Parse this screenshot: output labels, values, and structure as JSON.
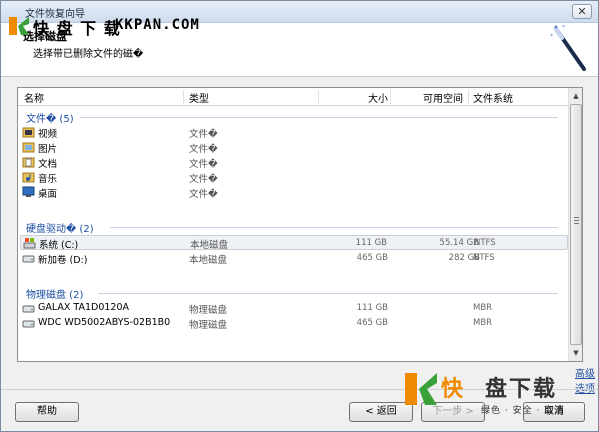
{
  "window": {
    "title": "文件恢复向导",
    "close_glyph": "✕"
  },
  "watermark_top": {
    "text_cn": "快 盘 下 载",
    "text_en": "KKPAN.COM"
  },
  "header": {
    "heading": "选择磁盘",
    "subtitle": "选择带已删除文件的磁�"
  },
  "columns": [
    "名称",
    "类型",
    "大小",
    "可用空间",
    "文件系统"
  ],
  "groups": [
    {
      "label": "文件� (5)",
      "rows": [
        {
          "name": "视频",
          "type": "文件�",
          "size": "",
          "free": "",
          "fs": "",
          "icon": "video-folder-icon"
        },
        {
          "name": "图片",
          "type": "文件�",
          "size": "",
          "free": "",
          "fs": "",
          "icon": "pictures-folder-icon"
        },
        {
          "name": "文档",
          "type": "文件�",
          "size": "",
          "free": "",
          "fs": "",
          "icon": "documents-folder-icon"
        },
        {
          "name": "音乐",
          "type": "文件�",
          "size": "",
          "free": "",
          "fs": "",
          "icon": "music-folder-icon"
        },
        {
          "name": "桌面",
          "type": "文件�",
          "size": "",
          "free": "",
          "fs": "",
          "icon": "desktop-folder-icon"
        }
      ]
    },
    {
      "label": "硬盘驱动� (2)",
      "rows": [
        {
          "name": "系统 (C:)",
          "type": "本地磁盘",
          "size": "111 GB",
          "free": "55.14 GB",
          "fs": "NTFS",
          "icon": "system-drive-icon",
          "selected": true
        },
        {
          "name": "新加卷 (D:)",
          "type": "本地磁盘",
          "size": "465 GB",
          "free": "282 GB",
          "fs": "NTFS",
          "icon": "drive-icon"
        }
      ]
    },
    {
      "label": "物理磁盘 (2)",
      "rows": [
        {
          "name": "GALAX TA1D0120A",
          "type": "物理磁盘",
          "size": "111 GB",
          "free": "",
          "fs": "MBR",
          "icon": "physical-disk-icon"
        },
        {
          "name": "WDC WD5002ABYS-02B1B0",
          "type": "物理磁盘",
          "size": "465 GB",
          "free": "",
          "fs": "MBR",
          "icon": "physical-disk-icon"
        }
      ]
    }
  ],
  "advanced_link": "高级选项",
  "buttons": {
    "help": "帮助",
    "back": "< 返回",
    "next": "下一步 >",
    "cancel": "取消"
  },
  "watermark_bottom": {
    "cn_orange": "快",
    "cn_dark": "盘下载",
    "sub": "绿色 · 安全 · 高速"
  },
  "colors": {
    "group_text": "#1e4fa3",
    "selection": "#eef1f5",
    "watermark_orange": "#f08a00"
  }
}
